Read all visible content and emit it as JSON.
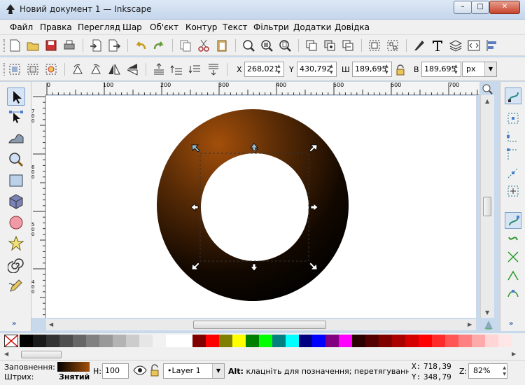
{
  "window": {
    "title": "Новий документ 1 — Inkscape",
    "min": "–",
    "max": "□",
    "close": "✕"
  },
  "menu": [
    "Файл",
    "Правка",
    "Перегляд",
    "Шар",
    "Об'єкт",
    "Контур",
    "Текст",
    "Фільтри",
    "Додатки",
    "Довідка"
  ],
  "toolbar2": {
    "x_label": "X",
    "x_value": "268,021",
    "y_label": "Y",
    "y_value": "430,792",
    "w_label": "Ш",
    "w_value": "189,695",
    "h_label": "В",
    "h_value": "189,695",
    "unit": "px"
  },
  "ruler": {
    "h_ticks": [
      "0",
      "100",
      "200",
      "300",
      "400",
      "500",
      "600",
      "700"
    ],
    "v_ticks": [
      "7 0 0",
      "6 0 0",
      "5 0 0",
      "4 0 0",
      "3 0 0"
    ]
  },
  "status": {
    "fill_label": "Заповнення:",
    "stroke_label": "Штрих:",
    "stroke_value": "Знятий",
    "opacity_label": "Н:",
    "opacity_value": "100",
    "layer": "•Layer 1",
    "message_bold": "Alt:",
    "message": " клацніть для позначення; перетягування д",
    "x_label": "X:",
    "x_value": "718,39",
    "y_label": "Y:",
    "y_value": "348,79",
    "zoom_label": "Z:",
    "zoom_value": "82%"
  },
  "more_glyph": "»",
  "icons": {
    "tools": [
      "selector-icon",
      "node-icon",
      "tweak-icon",
      "zoom-icon",
      "rect-icon",
      "box3d-icon",
      "ellipse-icon",
      "star-icon",
      "spiral-icon",
      "pencil-icon"
    ],
    "snap": [
      "snap-toggle-icon",
      "snap-bbox-icon",
      "snap-node-icon",
      "snap-path-icon"
    ]
  },
  "colors": {
    "ring_highlight": "#a34f0a",
    "ring_dark": "#000000",
    "palette": [
      "#000000",
      "#1a1a1a",
      "#333333",
      "#4d4d4d",
      "#666666",
      "#808080",
      "#999999",
      "#b3b3b3",
      "#cccccc",
      "#e6e6e6",
      "#f2f2f2",
      "#ffffff",
      "#ffffff",
      "#800000",
      "#ff0000",
      "#808000",
      "#ffff00",
      "#008000",
      "#00ff00",
      "#008080",
      "#00ffff",
      "#000080",
      "#0000ff",
      "#800080",
      "#ff00ff",
      "#2b0000",
      "#550000",
      "#800000",
      "#aa0000",
      "#d40000",
      "#ff0000",
      "#ff2a2a",
      "#ff5555",
      "#ff8080",
      "#ffaaaa",
      "#ffd5d5",
      "#ffe6e6"
    ]
  }
}
